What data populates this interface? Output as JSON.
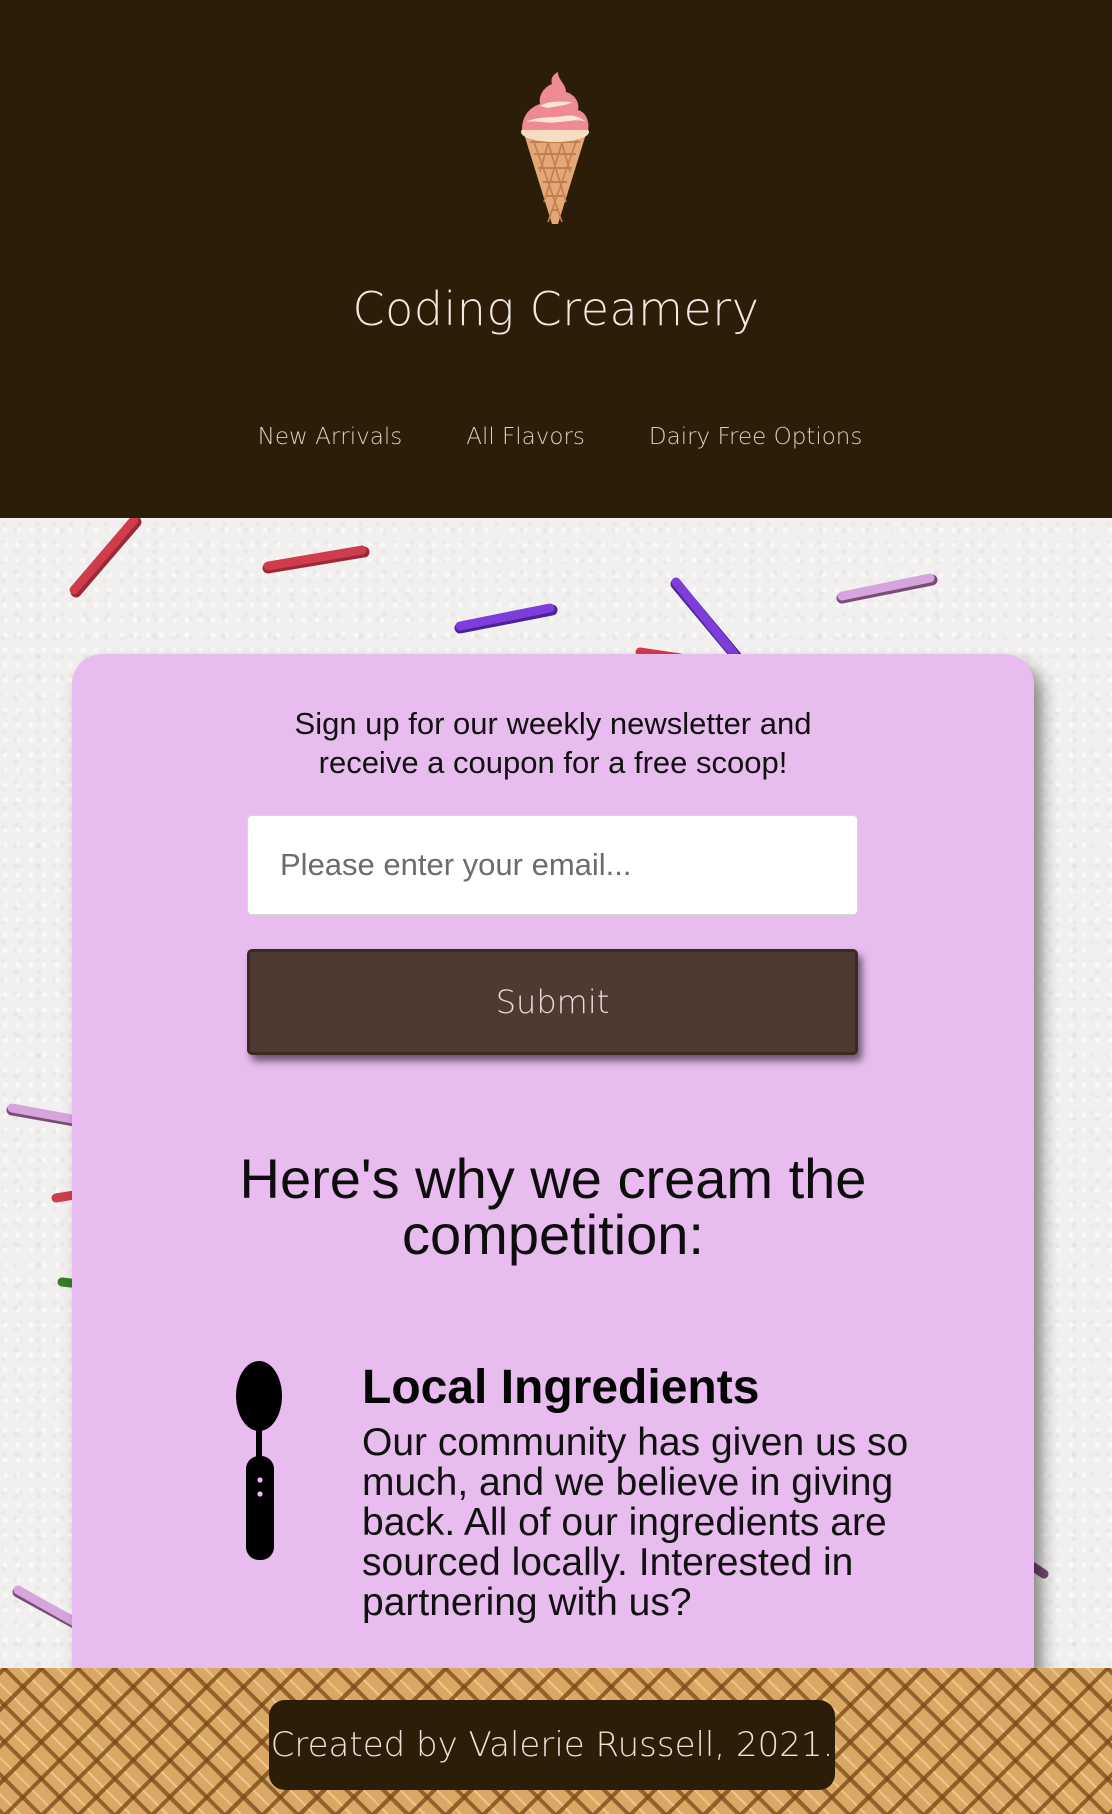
{
  "header": {
    "logo_icon": "ice-cream-cone-icon",
    "title": "Coding Creamery",
    "nav": [
      {
        "label": "New Arrivals"
      },
      {
        "label": "All Flavors"
      },
      {
        "label": "Dairy Free Options"
      }
    ]
  },
  "newsletter": {
    "text_line1": "Sign up for our weekly newsletter and",
    "text_line2": "receive a coupon for a free scoop!",
    "email_placeholder": "Please enter your email...",
    "email_value": "",
    "submit_label": "Submit"
  },
  "why": {
    "heading_line1": "Here's why we cream the",
    "heading_line2": "competition:"
  },
  "feature": {
    "icon": "spoon-icon",
    "title": "Local Ingredients",
    "body": "Our community has given us so much, and we believe in giving back. All of our ingredients are sourced locally. Interested in partnering with us?"
  },
  "footer": {
    "credit": "Created by Valerie Russell, 2021."
  },
  "colors": {
    "header_bg": "#2b1d08",
    "card_bg": "#e8bcee",
    "button_bg": "#4f3a32",
    "footer_waffle": "#d9a865"
  }
}
